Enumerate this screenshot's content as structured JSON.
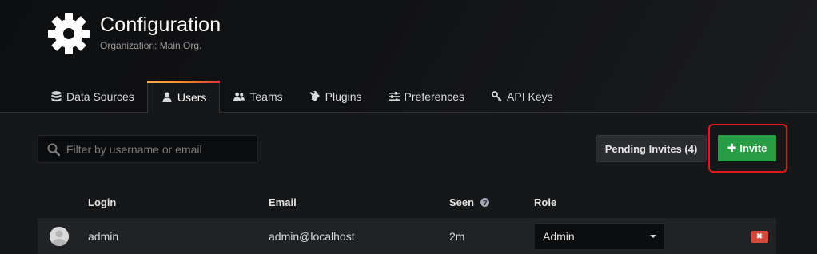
{
  "header": {
    "title": "Configuration",
    "subtitle": "Organization: Main Org.",
    "icon": "gear-icon"
  },
  "tabs": [
    {
      "label": "Data Sources",
      "icon": "database-icon",
      "active": false
    },
    {
      "label": "Users",
      "icon": "user-icon",
      "active": true
    },
    {
      "label": "Teams",
      "icon": "users-icon",
      "active": false
    },
    {
      "label": "Plugins",
      "icon": "plug-icon",
      "active": false
    },
    {
      "label": "Preferences",
      "icon": "sliders-icon",
      "active": false
    },
    {
      "label": "API Keys",
      "icon": "key-icon",
      "active": false
    }
  ],
  "search": {
    "placeholder": "Filter by username or email",
    "value": ""
  },
  "actions": {
    "pending_label": "Pending Invites (4)",
    "invite_label": "Invite",
    "invite_icon": "plus-icon"
  },
  "table": {
    "columns": {
      "login": "Login",
      "email": "Email",
      "seen": "Seen",
      "role": "Role"
    },
    "rows": [
      {
        "login": "admin",
        "email": "admin@localhost",
        "seen": "2m",
        "role": "Admin"
      }
    ]
  },
  "colors": {
    "accent_gradient": [
      "#ffad4d",
      "#e02f44"
    ],
    "primary_green": "#299c46",
    "danger_red": "#d44a3a",
    "highlight": "#e01a1a"
  }
}
